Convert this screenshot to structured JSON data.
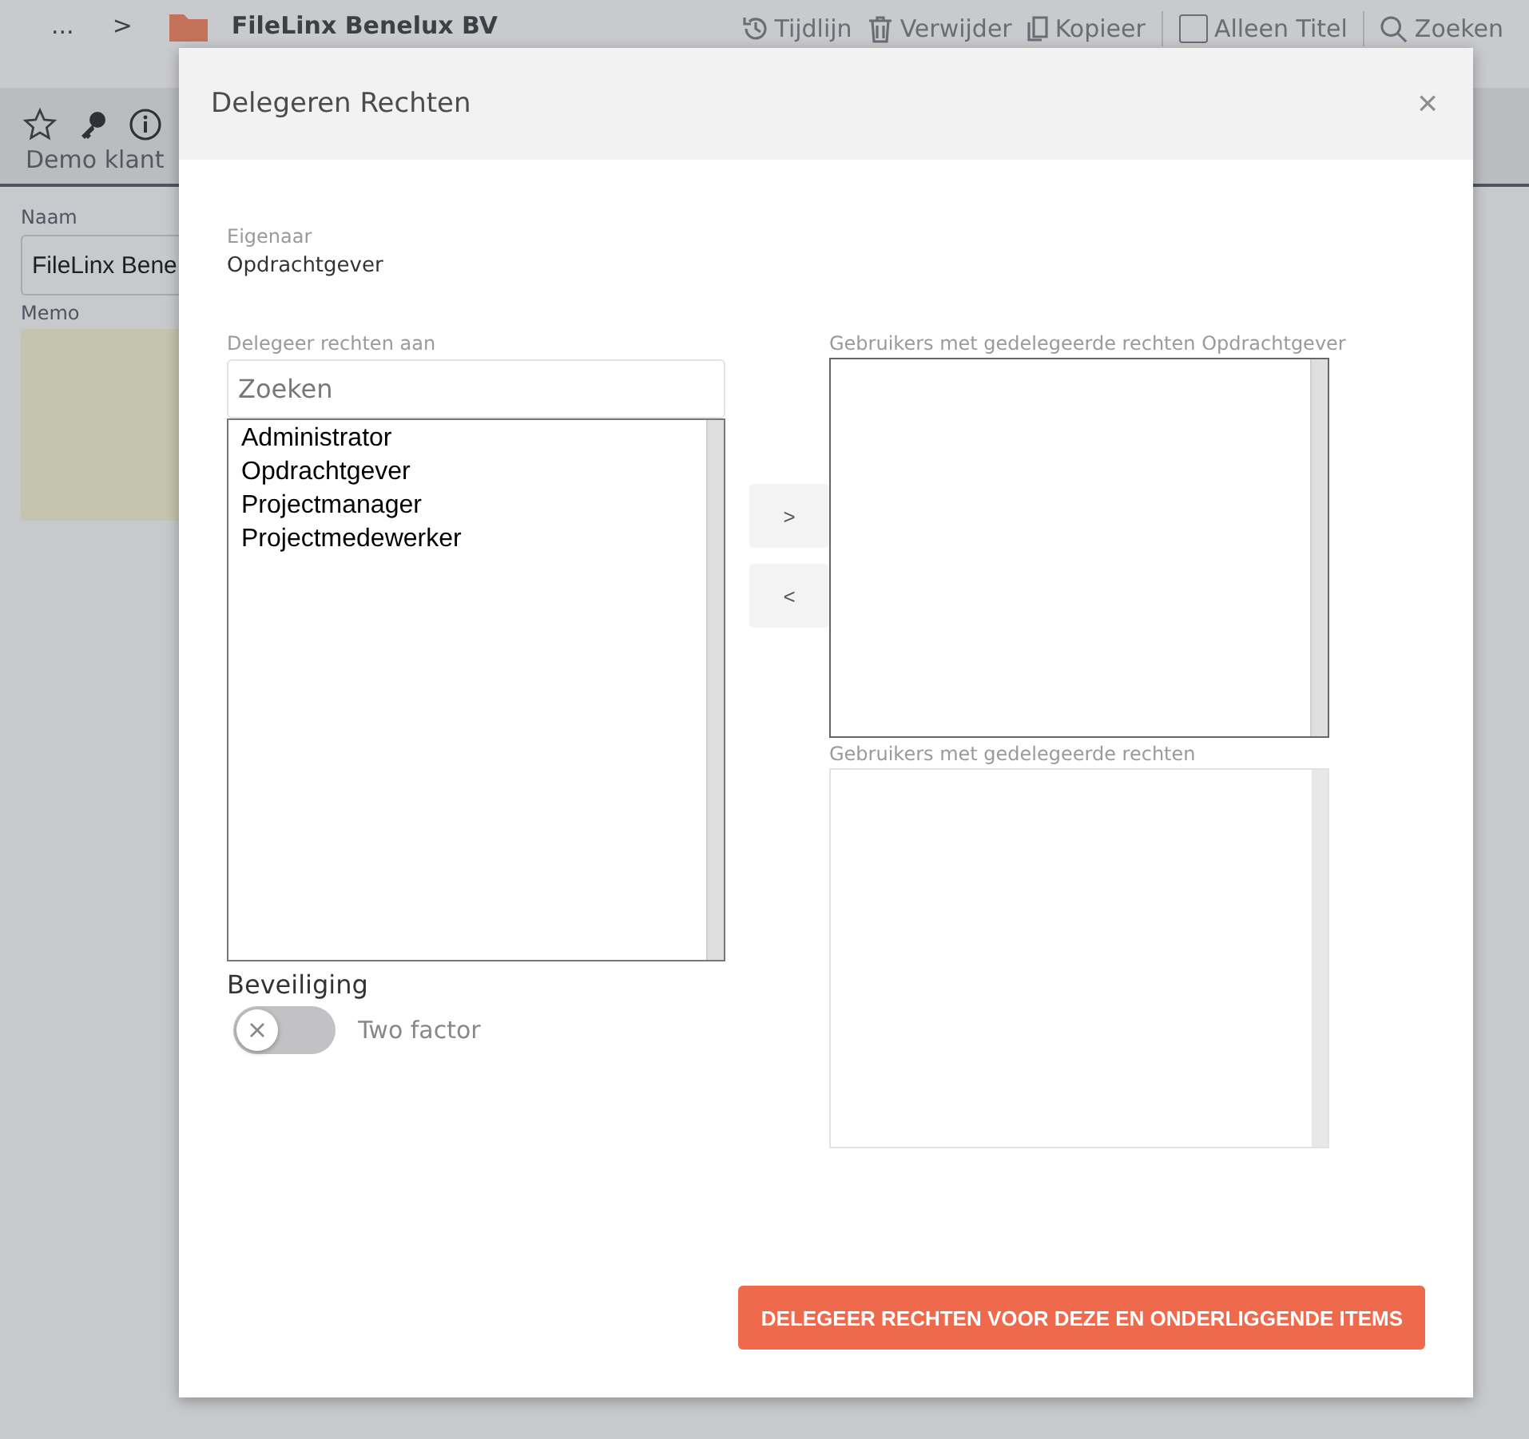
{
  "topbar": {
    "ellipsis": "...",
    "chevron": ">",
    "folder": "FileLinx Benelux BV",
    "actions": [
      {
        "kind": "history",
        "label": "Tijdlijn"
      },
      {
        "kind": "trash",
        "label": "Verwijder"
      },
      {
        "kind": "copy",
        "label": "Kopieer"
      },
      {
        "kind": "checkbox",
        "label": "Alleen Titel",
        "checked": false
      },
      {
        "kind": "search",
        "label": "Zoeken"
      }
    ]
  },
  "subbar": {
    "title": "Demo klant"
  },
  "form": {
    "name_label": "Naam",
    "name_value": "FileLinx Bene",
    "memo_label": "Memo"
  },
  "dialog": {
    "title": "Delegeren Rechten",
    "close": "×",
    "owner_label": "Eigenaar",
    "owner": "Opdrachtgever",
    "delegate_label": "Delegeer rechten aan",
    "search_placeholder": "Zoeken",
    "roles": [
      "Administrator",
      "Opdrachtgever",
      "Projectmanager",
      "Projectmedewerker"
    ],
    "add_button": ">",
    "remove_button": "<",
    "right_top_label": "Gebruikers met gedelegeerde rechten Opdrachtgever",
    "right_bottom_label": "Gebruikers met gedelegeerde rechten",
    "security_label": "Beveiliging",
    "toggle": {
      "label": "Two factor",
      "on": false
    },
    "submit": "DELEGEER RECHTEN VOOR DEZE EN ONDERLIGGENDE ITEMS"
  }
}
